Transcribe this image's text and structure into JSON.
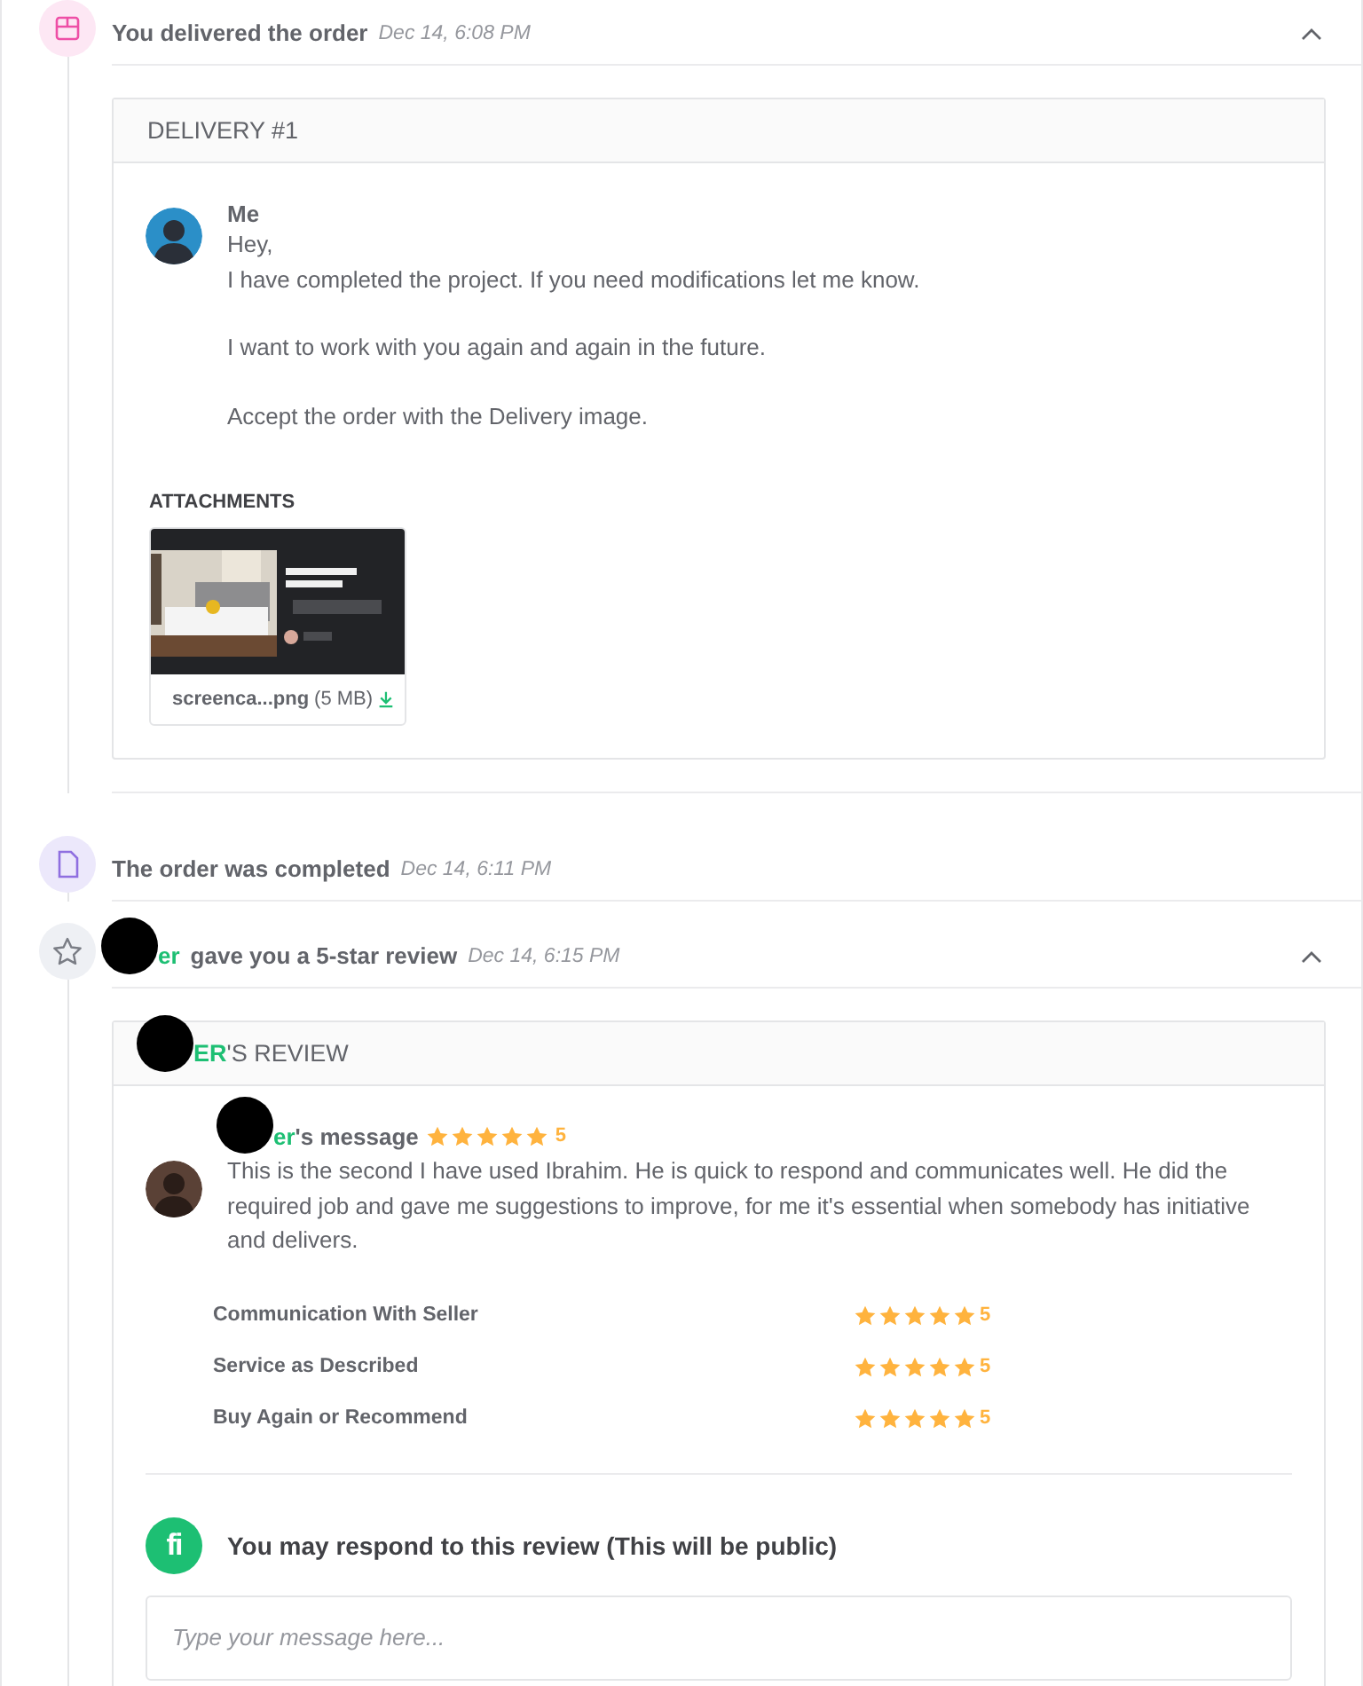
{
  "events": [
    {
      "kind": "delivery",
      "title": "You delivered the order",
      "time": "Dec 14, 6:08 PM",
      "expanded": true,
      "delivery": {
        "heading": "DELIVERY #1",
        "sender": "Me",
        "paragraphs": [
          "Hey,\nI have completed the project. If you need modifications let me know.",
          "I want to work with you again and again in the future.",
          "Accept the order with the Delivery image."
        ],
        "attachments_label": "ATTACHMENTS",
        "attachment": {
          "kind": "picture",
          "name": "screenca...png",
          "size": "(5 MB)"
        }
      }
    },
    {
      "kind": "completed",
      "title": "The order was completed",
      "time": "Dec 14, 6:11 PM",
      "expanded": false
    },
    {
      "kind": "review",
      "name": {
        "text": "er",
        "redacted": true
      },
      "title": "gave you a 5-star review",
      "time": "Dec 14, 6:15 PM",
      "expanded": true,
      "review": {
        "heading_name": {
          "text": "ER",
          "redacted": true
        },
        "heading_rest": "'S REVIEW",
        "message_name": {
          "text": "er",
          "redacted": true
        },
        "message_rest": "'s message",
        "stars": 5,
        "rating": "5",
        "text": "This is the second I have used Ibrahim. He is quick to respond and communicates well. He did the required job and gave me suggestions to improve, for me it's essential when somebody has initiative and delivers.",
        "ratings": [
          {
            "label": "Communication With Seller",
            "stars": 5,
            "score": "5"
          },
          {
            "label": "Service as Described",
            "stars": 5,
            "score": "5"
          },
          {
            "label": "Buy Again or Recommend",
            "stars": 5,
            "score": "5"
          }
        ],
        "respond": {
          "logo": "fi",
          "prompt": "You may respond to this review (This will be public)",
          "placeholder": "Type your message here..."
        }
      }
    }
  ]
}
